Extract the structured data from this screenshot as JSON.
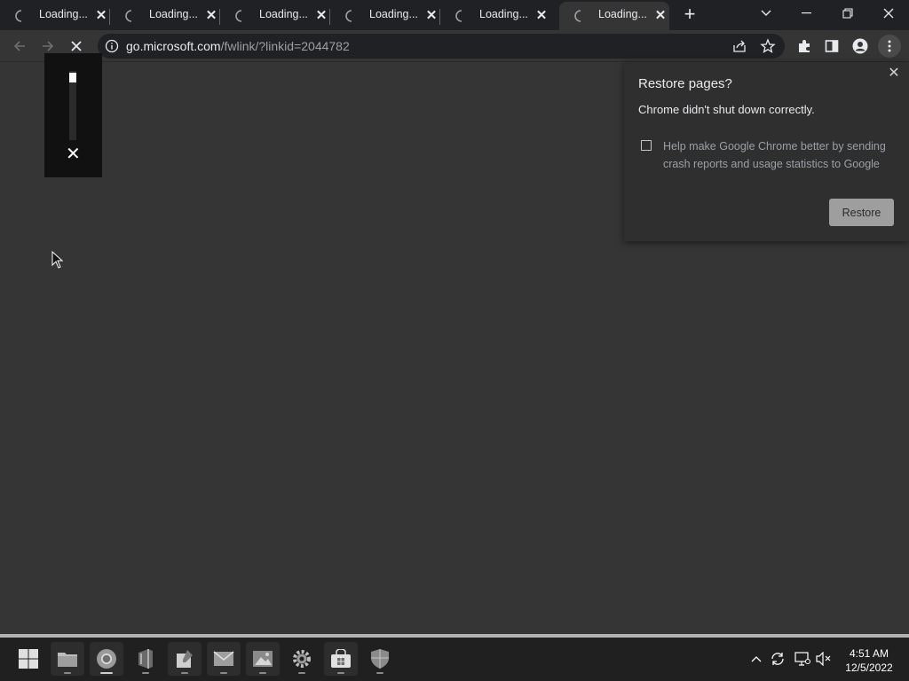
{
  "tabs": [
    {
      "title": "Loading..."
    },
    {
      "title": "Loading..."
    },
    {
      "title": "Loading..."
    },
    {
      "title": "Loading..."
    },
    {
      "title": "Loading..."
    },
    {
      "title": "Loading..."
    }
  ],
  "new_tab_label": "+",
  "omnibox": {
    "host": "go.microsoft.com",
    "path": "/fwlink/?linkid=2044782"
  },
  "zoom_popup": {
    "close_label": "✕",
    "level": 0.1
  },
  "restore_dialog": {
    "title": "Restore pages?",
    "message": "Chrome didn't shut down correctly.",
    "checkbox_label": "Help make Google Chrome better by sending crash reports and usage statistics to Google",
    "checkbox_checked": false,
    "button_label": "Restore",
    "close_label": "✕"
  },
  "taskbar": {
    "time": "4:51 AM",
    "date": "12/5/2022"
  },
  "colors": {
    "page_bg": "#353535",
    "tabstrip_bg": "#202124",
    "taskbar_bg": "#202020"
  }
}
